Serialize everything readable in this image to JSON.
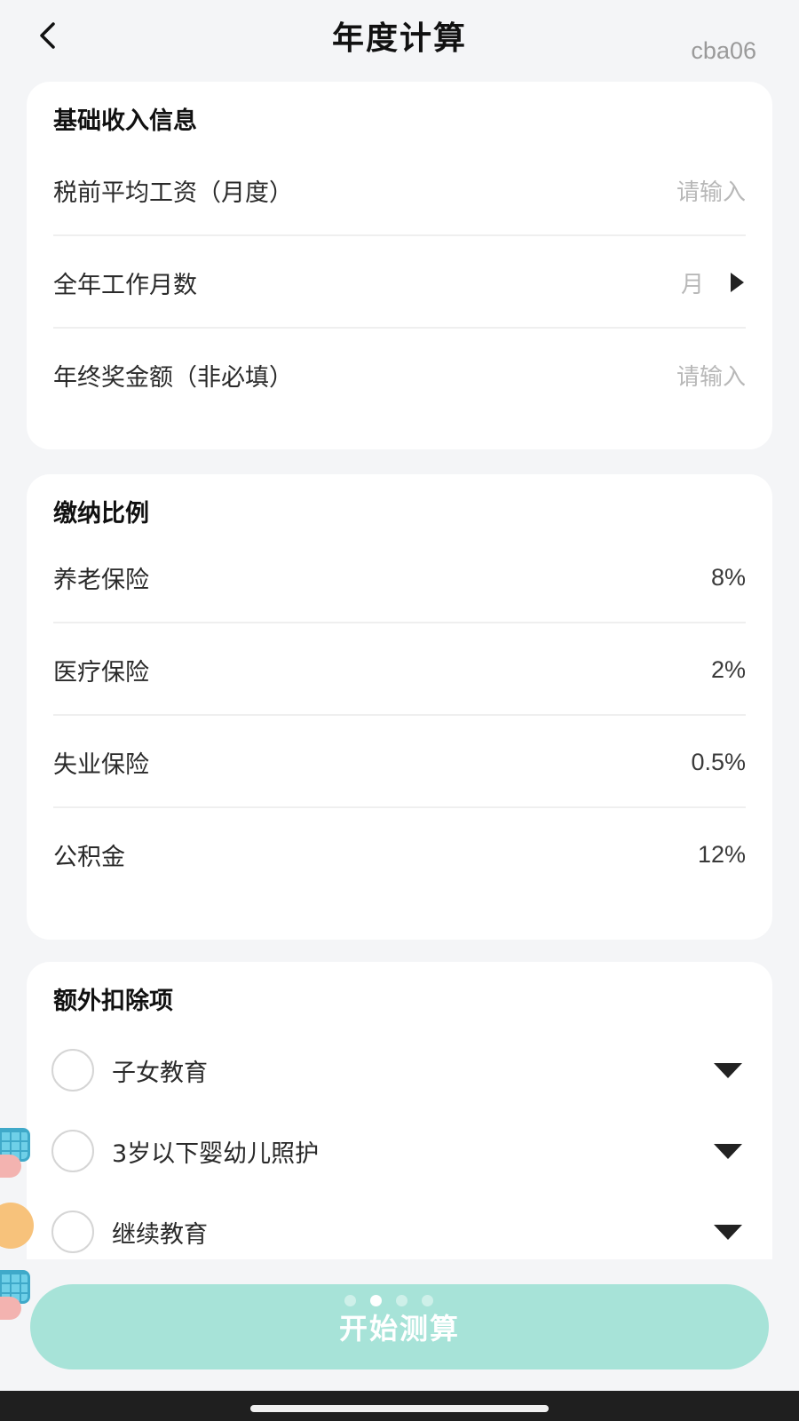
{
  "header": {
    "title": "年度计算",
    "code_tag": "cba06",
    "back_icon": "chevron-left-icon"
  },
  "basic_income": {
    "title": "基础收入信息",
    "rows": [
      {
        "label": "税前平均工资（月度）",
        "placeholder": "请输入"
      },
      {
        "label": "全年工作月数",
        "placeholder": "月",
        "icon": "triangle-right-icon"
      },
      {
        "label": "年终奖金额（非必填）",
        "placeholder": "请输入"
      }
    ]
  },
  "contribution": {
    "title": "缴纳比例",
    "rows": [
      {
        "label": "养老保险",
        "value": "8%"
      },
      {
        "label": "医疗保险",
        "value": "2%"
      },
      {
        "label": "失业保险",
        "value": "0.5%"
      },
      {
        "label": "公积金",
        "value": "12%"
      }
    ]
  },
  "deductions": {
    "title": "额外扣除项",
    "items": [
      {
        "label": "子女教育",
        "checked": false
      },
      {
        "label": "3岁以下婴幼儿照护",
        "checked": false
      },
      {
        "label": "继续教育",
        "checked": false
      }
    ]
  },
  "action": {
    "start_label": "开始测算",
    "color": "#a7e3d8",
    "carousel_pages": 4,
    "carousel_active_index": 1
  },
  "colors": {
    "background": "#f4f5f7",
    "card": "#ffffff",
    "placeholder": "#b8b8b8"
  }
}
